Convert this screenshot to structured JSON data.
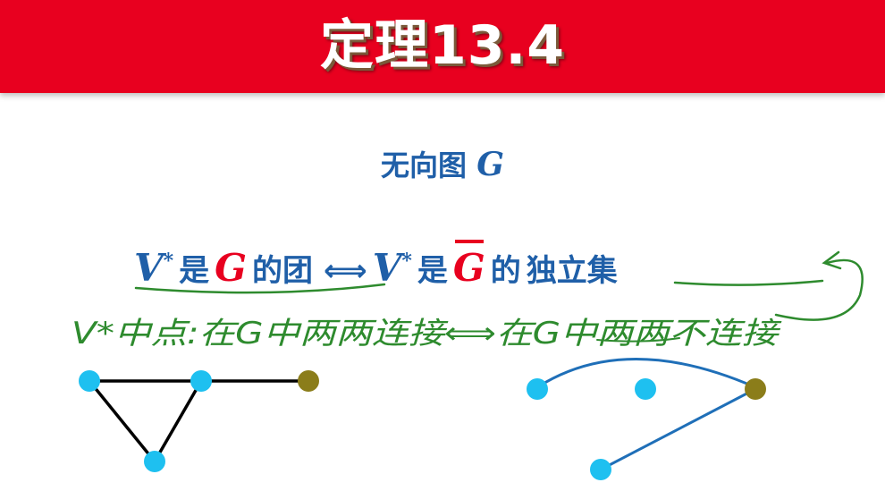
{
  "banner": {
    "title": "定理13.4"
  },
  "subtitle": {
    "prefix": "无向图",
    "graph": "G"
  },
  "theorem": {
    "v_left": "V",
    "star_left": "*",
    "is_left": "是",
    "g_left": "G",
    "clique": "的团",
    "iff": "⟺",
    "v_right": "V",
    "star_right": "*",
    "is_right": "是",
    "g_right": "G",
    "indep_prefix": "的",
    "independent_set": "独立集"
  },
  "handwriting": {
    "line": "V*中点:在G中两两连接⟺在G中两两不连接"
  },
  "colors": {
    "banner": "#e8001f",
    "title_blue": "#1f5fa8",
    "accent_red": "#e8001f",
    "ink_green": "#2e8b2e",
    "vertex_cyan": "#1ec0f0",
    "vertex_olive": "#8b7d1a",
    "edge_black": "#000000",
    "edge_blue": "#1f6fb8"
  },
  "graphs": {
    "left": {
      "vertices": [
        "a",
        "b",
        "c",
        "d"
      ],
      "vertex_colors": [
        "cyan",
        "cyan",
        "cyan",
        "olive"
      ],
      "edges": [
        [
          "a",
          "b"
        ],
        [
          "a",
          "c"
        ],
        [
          "b",
          "c"
        ],
        [
          "b",
          "d"
        ]
      ]
    },
    "right": {
      "vertices": [
        "a",
        "b",
        "c",
        "d"
      ],
      "vertex_colors": [
        "cyan",
        "cyan",
        "cyan",
        "olive"
      ],
      "edges": [
        [
          "a",
          "d"
        ],
        [
          "c",
          "d"
        ]
      ]
    }
  }
}
